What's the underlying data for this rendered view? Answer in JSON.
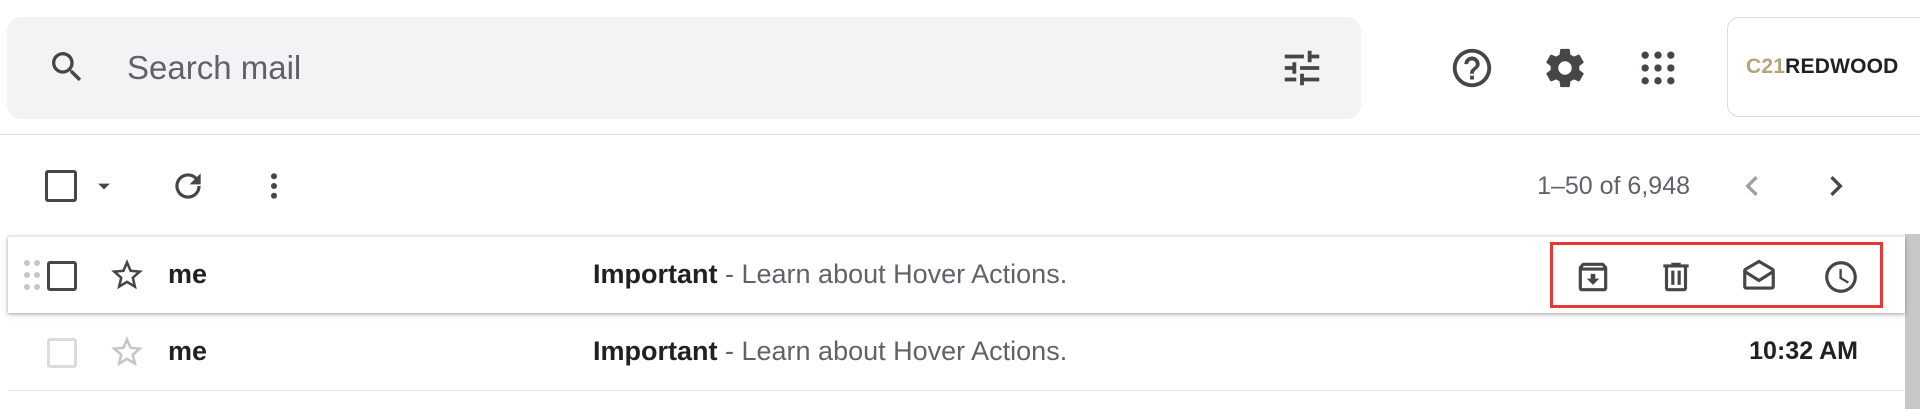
{
  "search": {
    "placeholder": "Search mail"
  },
  "brand": {
    "prefix": "C21",
    "name": "REDWOOD"
  },
  "toolbar": {
    "pagination": "1–50 of 6,948"
  },
  "emails": [
    {
      "sender": "me",
      "subject": "Important",
      "snippet": " - Learn about Hover Actions.",
      "time": "",
      "hovered": true,
      "hover_actions": [
        "archive",
        "delete",
        "mark-as-read",
        "snooze"
      ]
    },
    {
      "sender": "me",
      "subject": "Important",
      "snippet": " - Learn about Hover Actions.",
      "time": "10:32 AM",
      "hovered": false
    }
  ],
  "icons": {
    "header": [
      "search-icon",
      "search-options-icon",
      "help-icon",
      "settings-icon",
      "apps-grid-icon"
    ],
    "toolbar": [
      "checkbox-icon",
      "chevron-down-icon",
      "refresh-icon",
      "more-vert-icon",
      "chevron-left-icon",
      "chevron-right-icon"
    ]
  },
  "colors": {
    "search_bg": "#f1f3f4",
    "highlight": "#e53935",
    "brand_accent": "#b5a67a",
    "text_primary": "#202124",
    "text_secondary": "#5f6368"
  }
}
